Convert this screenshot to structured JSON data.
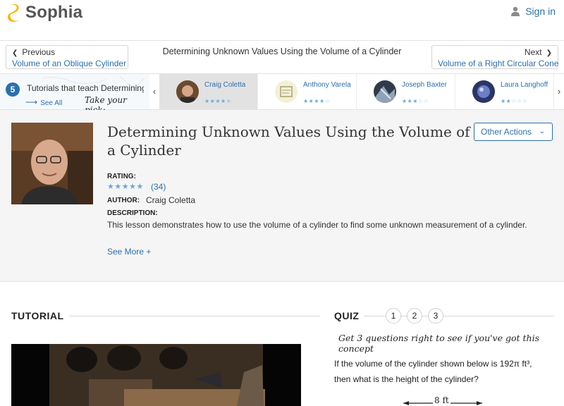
{
  "brand": {
    "name": "Sophia",
    "color": "#f5b90a"
  },
  "header": {
    "signin_label": "Sign in"
  },
  "nav": {
    "prev_label": "Previous",
    "prev_link": "Volume of an Oblique Cylinder",
    "title": "Determining Unknown Values Using the Volume of a Cylinder",
    "next_label": "Next",
    "next_link": "Volume of a Right Circular Cone"
  },
  "tutorials": {
    "count": "5",
    "label": "Tutorials that teach Determining Unknown Values Using the Volume of a Cylinder",
    "see_all": "See All",
    "take_pick": "Take your pick:",
    "cards": [
      {
        "name": "Craig Coletta",
        "stars": 4.5,
        "active": true
      },
      {
        "name": "Anthony Varela",
        "stars": 4,
        "active": false
      },
      {
        "name": "Joseph Baxter",
        "stars": 3,
        "active": false
      },
      {
        "name": "Laura Langhoff",
        "stars": 2.5,
        "active": false
      }
    ]
  },
  "lesson": {
    "title": "Determining Unknown Values Using the Volume of a Cylinder",
    "other_actions": "Other Actions",
    "rating_label": "RATING:",
    "rating_stars": "★★★★★",
    "rating_count": "(34)",
    "author_label": "AUTHOR:",
    "author_name": "Craig Coletta",
    "description_label": "DESCRIPTION:",
    "description": "This lesson demonstrates how to use the volume of a cylinder to find some unknown measurement of a cylinder.",
    "see_more": "See More +"
  },
  "tutorial_section": {
    "heading": "TUTORIAL"
  },
  "quiz": {
    "heading": "QUIZ",
    "numbers": [
      "1",
      "2",
      "3"
    ],
    "subtitle": "Get 3 questions right to see if you've got this concept",
    "question_line1": "If the volume of the cylinder shown below is 192π ft³,",
    "question_line2": "then what is the height of the cylinder?",
    "measure_label": "8 ft"
  }
}
